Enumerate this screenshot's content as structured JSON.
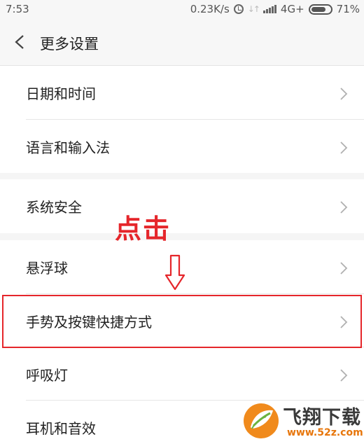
{
  "status_bar": {
    "time": "7:53",
    "net_speed": "0.23K/s",
    "network": "4G+",
    "battery": "71%",
    "icons": [
      "alarm-icon",
      "data-icon",
      "signal-icon",
      "battery-icon"
    ]
  },
  "header": {
    "title": "更多设置",
    "back_icon": "chevron-left-icon"
  },
  "groups": [
    {
      "items": [
        {
          "label": "日期和时间"
        },
        {
          "label": "语言和输入法"
        }
      ]
    },
    {
      "items": [
        {
          "label": "系统安全"
        }
      ]
    },
    {
      "items": [
        {
          "label": "悬浮球"
        },
        {
          "label": "手势及按键快捷方式",
          "highlighted": true
        },
        {
          "label": "呼吸灯"
        },
        {
          "label": "耳机和音效"
        }
      ]
    }
  ],
  "annotation": {
    "text": "点击",
    "color": "#e5262b",
    "arrow_icon": "down-arrow-icon"
  },
  "watermark": {
    "name": "飞翔下载",
    "url": "www.52z.com"
  },
  "colors": {
    "background": "#f5f5f5",
    "row_bg": "#ffffff",
    "highlight": "#e5262b",
    "chevron": "#b0b0b0"
  }
}
